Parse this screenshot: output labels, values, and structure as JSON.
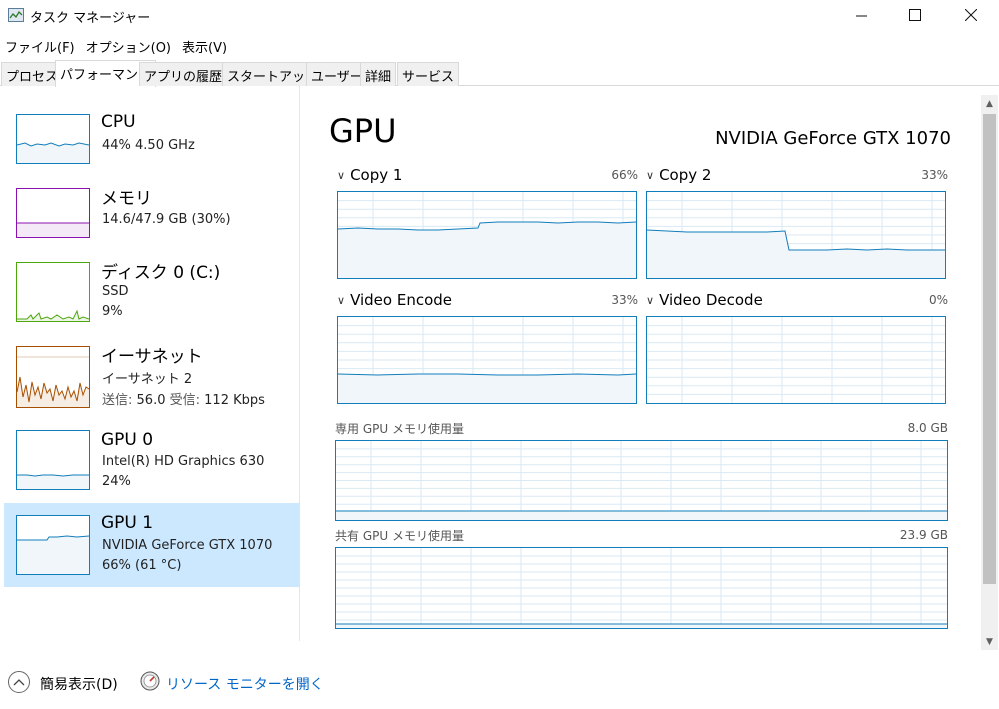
{
  "window": {
    "title": "タスク マネージャー",
    "icon": "task-manager-icon"
  },
  "menu": [
    "ファイル(F)",
    "オプション(O)",
    "表示(V)"
  ],
  "tabs": [
    {
      "label": "プロセス",
      "active": false
    },
    {
      "label": "パフォーマンス",
      "active": true
    },
    {
      "label": "アプリの履歴",
      "active": false
    },
    {
      "label": "スタートアップ",
      "active": false
    },
    {
      "label": "ユーザー",
      "active": false
    },
    {
      "label": "詳細",
      "active": false
    },
    {
      "label": "サービス",
      "active": false
    }
  ],
  "sidebar": {
    "items": [
      {
        "name": "CPU",
        "line1": "44% 4.50 GHz",
        "line2": "",
        "color": "#117dbb",
        "selected": false
      },
      {
        "name": "メモリ",
        "line1": "14.6/47.9 GB (30%)",
        "line2": "",
        "color": "#8b12ae",
        "selected": false
      },
      {
        "name": "ディスク 0 (C:)",
        "line1": "SSD",
        "line2": "9%",
        "color": "#4da60c",
        "selected": false
      },
      {
        "name": "イーサネット",
        "line1": "イーサネット 2",
        "line2_send_label": "送信:",
        "line2_send_val": "56.0",
        "line2_recv_label": "受信:",
        "line2_recv_val": "112 Kbps",
        "color": "#a74f01",
        "selected": false
      },
      {
        "name": "GPU 0",
        "line1": "Intel(R) HD Graphics 630",
        "line2": "24%",
        "color": "#117dbb",
        "selected": false
      },
      {
        "name": "GPU 1",
        "line1": "NVIDIA GeForce GTX 1070",
        "line2": "66% (61 °C)",
        "color": "#117dbb",
        "selected": true
      }
    ]
  },
  "main": {
    "title": "GPU",
    "model": "NVIDIA GeForce GTX 1070",
    "engines": [
      {
        "label": "Copy 1",
        "percent": "66%",
        "level": 0.66
      },
      {
        "label": "Copy 2",
        "percent": "33%",
        "level": 0.33
      },
      {
        "label": "Video Encode",
        "percent": "33%",
        "level": 0.33
      },
      {
        "label": "Video Decode",
        "percent": "0%",
        "level": 0.0
      }
    ],
    "dedicated_memory": {
      "label": "専用 GPU メモリ使用量",
      "value": "8.0 GB"
    },
    "shared_memory": {
      "label": "共有 GPU メモリ使用量",
      "value": "23.9 GB"
    }
  },
  "footer": {
    "fewer_details": "簡易表示(D)",
    "resource_monitor": "リソース モニターを開く"
  },
  "colors": {
    "accent": "#117dbb",
    "selected_bg": "#cce8ff",
    "link": "#0066cc"
  }
}
